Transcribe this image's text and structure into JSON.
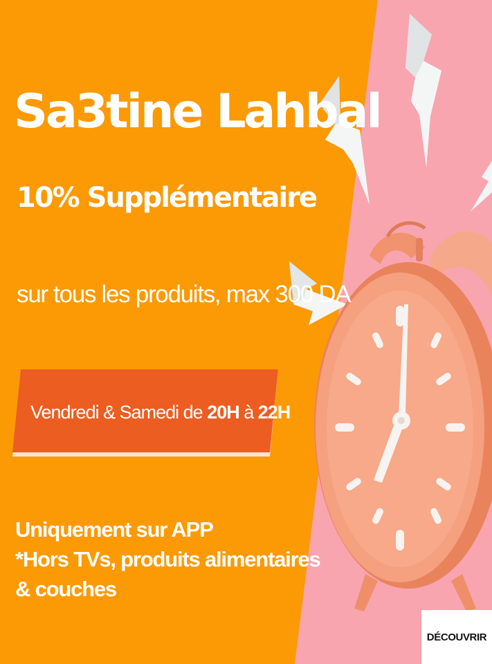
{
  "promo": {
    "headline": "Sa3tine Lahbal",
    "subheadline": "10% Supplémentaire",
    "offer_line": "sur tous les produits, max 300 DA",
    "schedule": {
      "prefix": "Vendredi & Samedi de ",
      "start": "20H",
      "connector": " à ",
      "end": "22H"
    },
    "notes": [
      "Uniquement sur APP",
      "*Hors TVs, produits alimentaires",
      "& couches"
    ],
    "cta_label": "DÉCOUVRIR"
  },
  "colors": {
    "orange": "#fb9a05",
    "pink": "#f8a5b0",
    "ribbon": "#ec5d22",
    "clock": "#f5a07f"
  },
  "icons": {
    "illustration": "alarm-clock-icon",
    "accents": "lightning-bolt-icon"
  }
}
